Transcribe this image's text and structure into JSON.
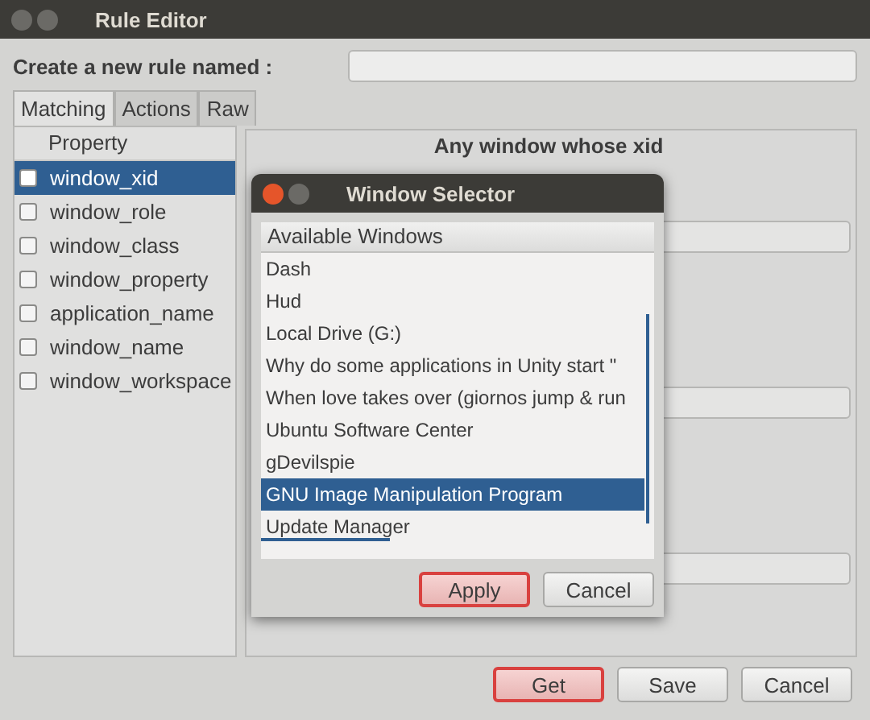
{
  "window": {
    "title": "Rule Editor"
  },
  "rule_name": {
    "label": "Create a new rule named :"
  },
  "tabs": [
    {
      "label": "Matching",
      "selected": true
    },
    {
      "label": "Actions",
      "selected": false
    },
    {
      "label": "Raw",
      "selected": false
    }
  ],
  "property_list": {
    "column": "Property",
    "items": [
      {
        "name": "window_xid",
        "checked": false,
        "selected": true
      },
      {
        "name": "window_role",
        "checked": false,
        "selected": false
      },
      {
        "name": "window_class",
        "checked": false,
        "selected": false
      },
      {
        "name": "window_property",
        "checked": false,
        "selected": false
      },
      {
        "name": "application_name",
        "checked": false,
        "selected": false
      },
      {
        "name": "window_name",
        "checked": false,
        "selected": false
      },
      {
        "name": "window_workspace",
        "checked": false,
        "selected": false
      }
    ]
  },
  "detail": {
    "heading": "Any window whose xid"
  },
  "buttons": [
    {
      "label": "Get",
      "default": true
    },
    {
      "label": "Save",
      "default": false
    },
    {
      "label": "Cancel",
      "default": false
    }
  ],
  "dialog": {
    "title": "Window Selector",
    "column": "Available Windows",
    "items": [
      {
        "name": "Dash",
        "selected": false
      },
      {
        "name": "Hud",
        "selected": false
      },
      {
        "name": "Local Drive (G:)",
        "selected": false
      },
      {
        "name": "Why do some applications in Unity start \"",
        "selected": false
      },
      {
        "name": "When love takes over (giornos jump & run",
        "selected": false
      },
      {
        "name": "Ubuntu Software Center",
        "selected": false
      },
      {
        "name": "gDevilspie",
        "selected": false
      },
      {
        "name": "GNU Image Manipulation Program",
        "selected": true
      },
      {
        "name": "Update Manager",
        "selected": false
      }
    ],
    "buttons": [
      {
        "label": "Apply",
        "default": true
      },
      {
        "label": "Cancel",
        "default": false
      }
    ]
  }
}
